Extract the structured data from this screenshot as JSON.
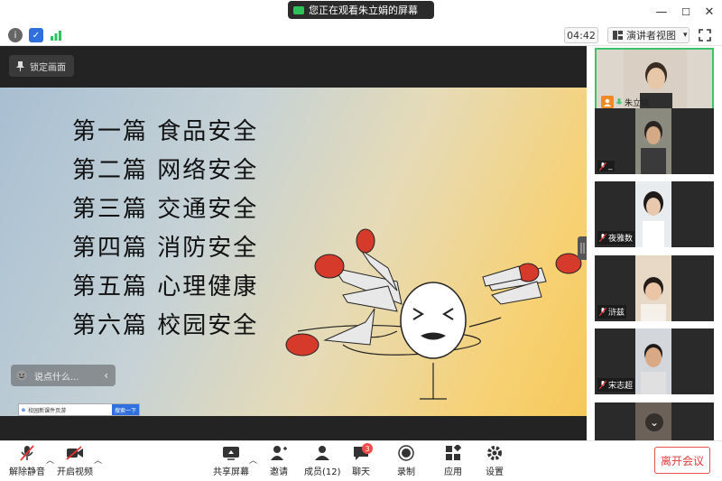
{
  "titlebar": {
    "sharing_notice": "您正在观看朱立娟的屏幕",
    "minimize": "—",
    "maximize": "☐",
    "close": "✕"
  },
  "toolbar": {
    "timer": "04:42",
    "view_mode": "演讲者视图",
    "view_caret": "▾"
  },
  "stage": {
    "lock_label": "锁定画面"
  },
  "slide": {
    "chapters": [
      "第一篇 食品安全",
      "第二篇 网络安全",
      "第三篇 交通安全",
      "第四篇 消防安全",
      "第五篇 心理健康",
      "第六篇 校园安全"
    ],
    "taskbar_text": "校园新课件页游",
    "taskbar_button": "搜索一下"
  },
  "chat": {
    "placeholder": "说点什么...",
    "arrow": "‹"
  },
  "participants": [
    {
      "name": "朱立娟",
      "host": true
    },
    {
      "name": "_",
      "host": false
    },
    {
      "name": "夜雅数",
      "host": false
    },
    {
      "name": "浒兹",
      "host": false
    },
    {
      "name": "宋志超",
      "host": false
    },
    {
      "name": "",
      "host": false
    }
  ],
  "scroll_down": "⌄",
  "bottombar": {
    "unmute": "解除静音",
    "start_video": "开启视频",
    "share_screen": "共享屏幕",
    "invite": "邀请",
    "members": "成员(12)",
    "chat": "聊天",
    "chat_badge": "3",
    "record": "录制",
    "apps": "应用",
    "settings": "设置",
    "leave": "离开会议"
  },
  "colors": {
    "accent": "#2f6fde",
    "leave": "#e03a3a",
    "badge": "#f04b4b",
    "signal": "#2cc35b"
  }
}
